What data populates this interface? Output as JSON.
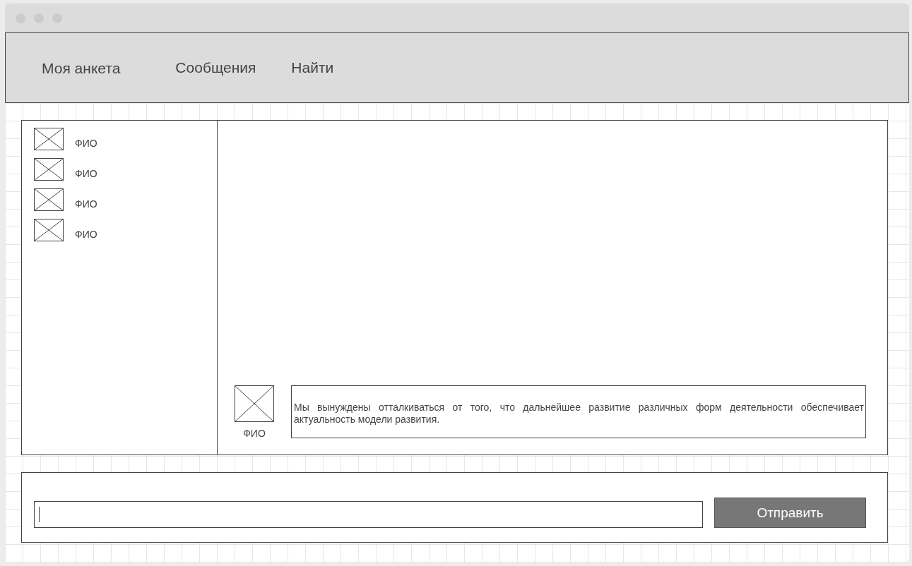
{
  "nav": [
    "Моя анкета",
    "Сообщения",
    "Найти"
  ],
  "contacts": [
    {
      "name": "ФИО"
    },
    {
      "name": "ФИО"
    },
    {
      "name": "ФИО"
    },
    {
      "name": "ФИО"
    }
  ],
  "message": {
    "name": "ФИО",
    "text": "Мы вынуждены отталкиваться от того, что дальнейшее развитие различных форм деятельности обеспечивает актуальность модели развития."
  },
  "composer": {
    "button": "Отправить"
  }
}
